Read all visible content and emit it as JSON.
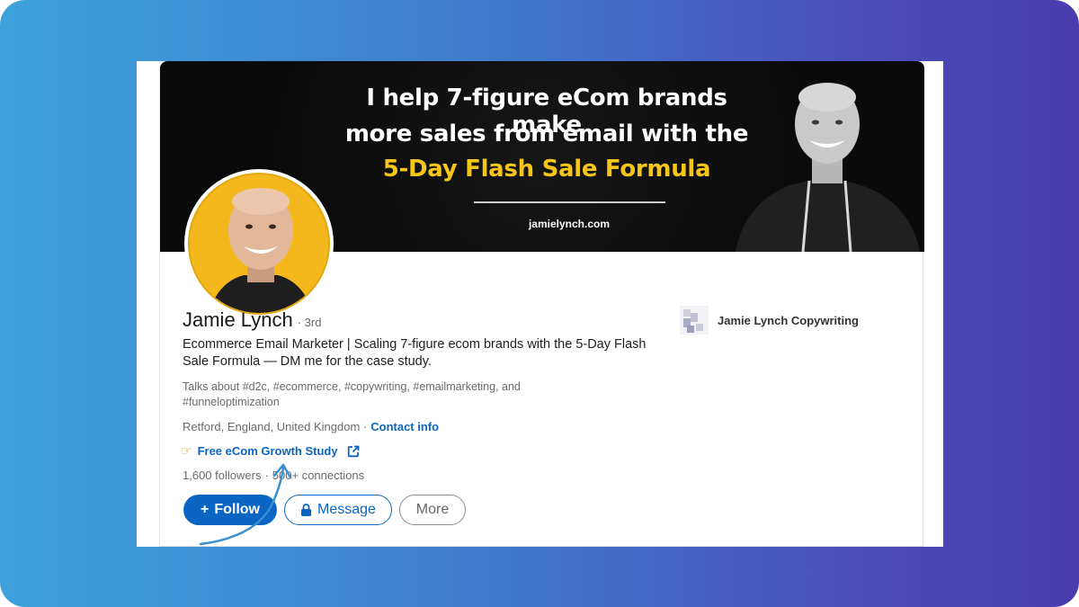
{
  "banner": {
    "line1": "I help 7-figure eCom brands make",
    "line2": "more sales from email with the",
    "line3": "5-Day Flash Sale Formula",
    "url": "jamielynch.com"
  },
  "profile": {
    "name": "Jamie Lynch",
    "degree": "· 3rd",
    "headline": "Ecommerce Email Marketer | Scaling 7-figure ecom brands with the 5-Day Flash Sale Formula — DM me for the case study.",
    "talks": "Talks about #d2c, #ecommerce, #copywriting, #emailmarketing, and #funneloptimization",
    "location": "Retford, England, United Kingdom ·",
    "contact_label": "Contact info",
    "link_label": "Free eCom Growth Study",
    "followers": "1,600 followers",
    "connections": "500+ connections",
    "company": "Jamie Lynch Copywriting"
  },
  "actions": {
    "follow_label": "Follow",
    "follow_prefix": "+",
    "message_label": "Message",
    "more_label": "More"
  },
  "colors": {
    "brand_blue": "#0a66c2",
    "banner_accent": "#f5c518",
    "avatar_bg": "#f4b81c",
    "arrow": "#3a8fd0"
  },
  "icons": {
    "link_prefix": "pointing-hand-icon",
    "link_suffix": "external-link-icon",
    "message": "lock-icon"
  }
}
